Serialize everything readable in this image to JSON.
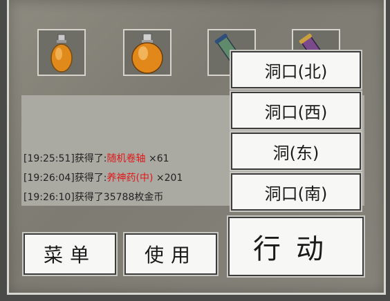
{
  "inventory": [
    {
      "name": "small-orange-potion-icon"
    },
    {
      "name": "large-orange-potion-icon"
    },
    {
      "name": "green-scroll-icon"
    },
    {
      "name": "purple-scroll-icon"
    }
  ],
  "log": [
    {
      "time": "[19:25:51]",
      "prefix": "获得了:",
      "item": "随机卷轴",
      "suffix": " ×61"
    },
    {
      "time": "[19:26:04]",
      "prefix": "获得了:",
      "item": "养神药(中)",
      "suffix": " ×201"
    },
    {
      "time": "[19:26:10]",
      "prefix": "获得了35788枚金币",
      "item": "",
      "suffix": ""
    }
  ],
  "locations": [
    "洞口(北)",
    "洞口(西)",
    "洞(东)",
    "洞口(南)"
  ],
  "buttons": {
    "menu": "菜单",
    "use": "使用",
    "action": "行动"
  },
  "colors": {
    "highlight": "#e01818",
    "button_bg": "#f7f7f5"
  }
}
